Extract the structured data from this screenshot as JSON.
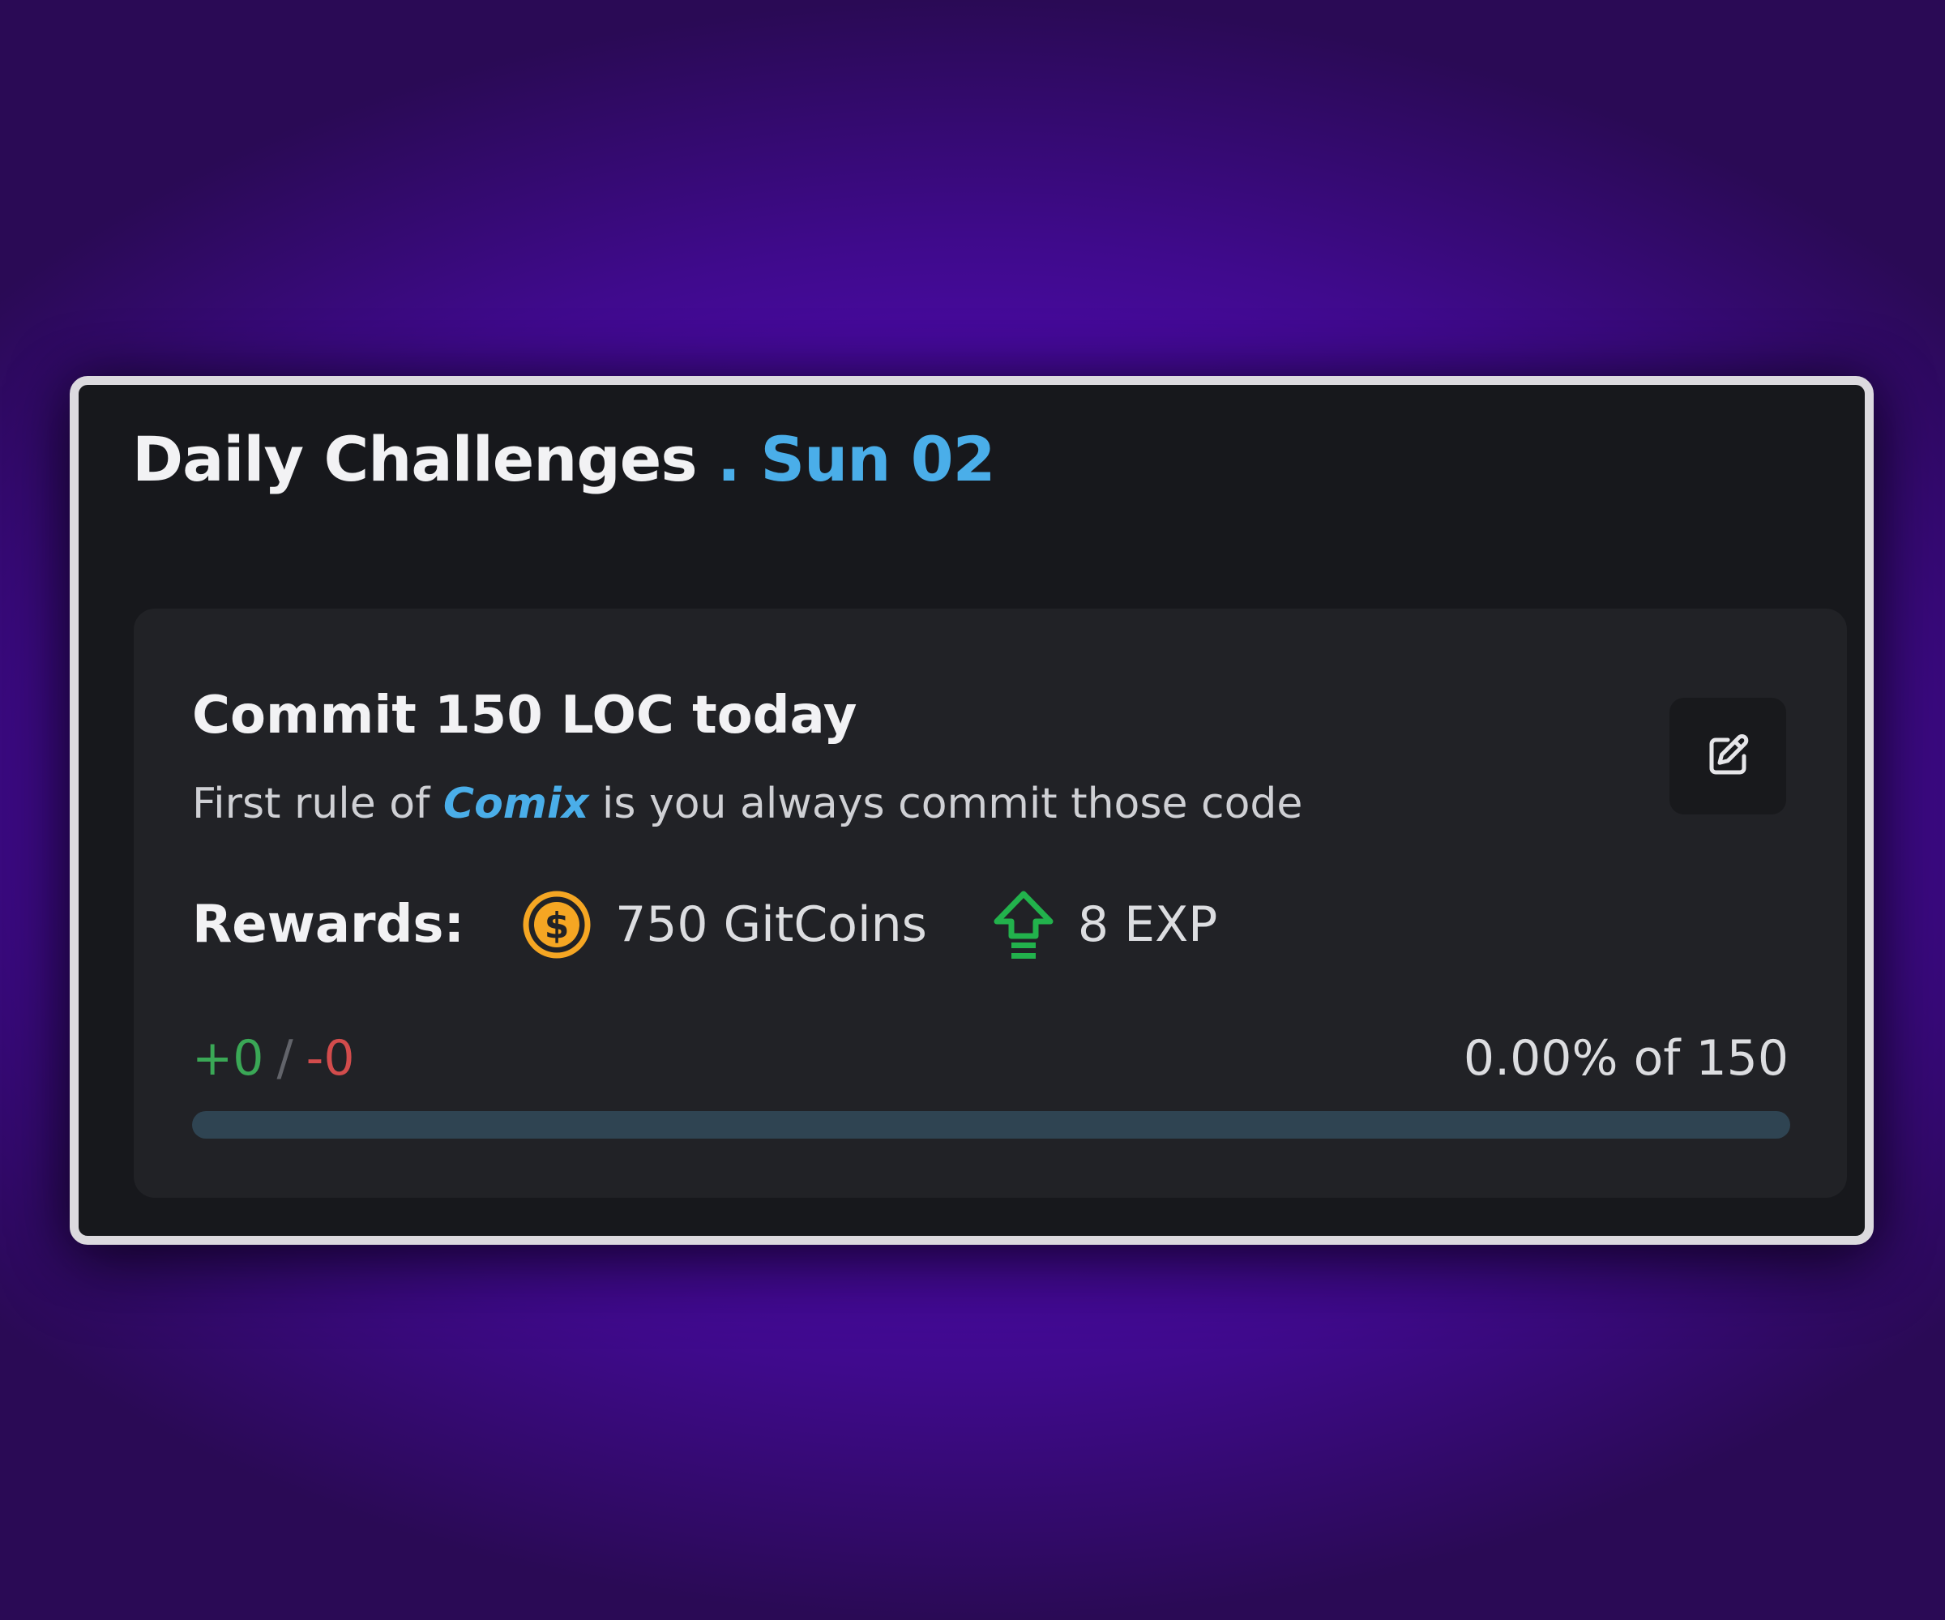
{
  "panel": {
    "title": "Daily Challenges",
    "date": ". Sun 02"
  },
  "challenge": {
    "title": "Commit 150 LOC today",
    "description_prefix": "First rule of",
    "description_brand": "Comix",
    "description_suffix": "is you always commit those code",
    "edit_icon": "edit-icon",
    "rewards": {
      "label": "Rewards:",
      "coins_text": "750 GitCoins",
      "coins_icon": "dollar-coin-icon",
      "exp_text": "8 EXP",
      "exp_icon": "level-up-arrow-icon"
    },
    "progress": {
      "added": "+0",
      "separator": "/",
      "removed": "-0",
      "percent_text": "0.00% of 150",
      "fraction": 0
    }
  },
  "colors": {
    "accent": "#4aaee9",
    "coin": "#f5a623",
    "exp": "#22b24c",
    "added": "#3aa856",
    "removed": "#d24c4c",
    "track": "#2f4452"
  }
}
